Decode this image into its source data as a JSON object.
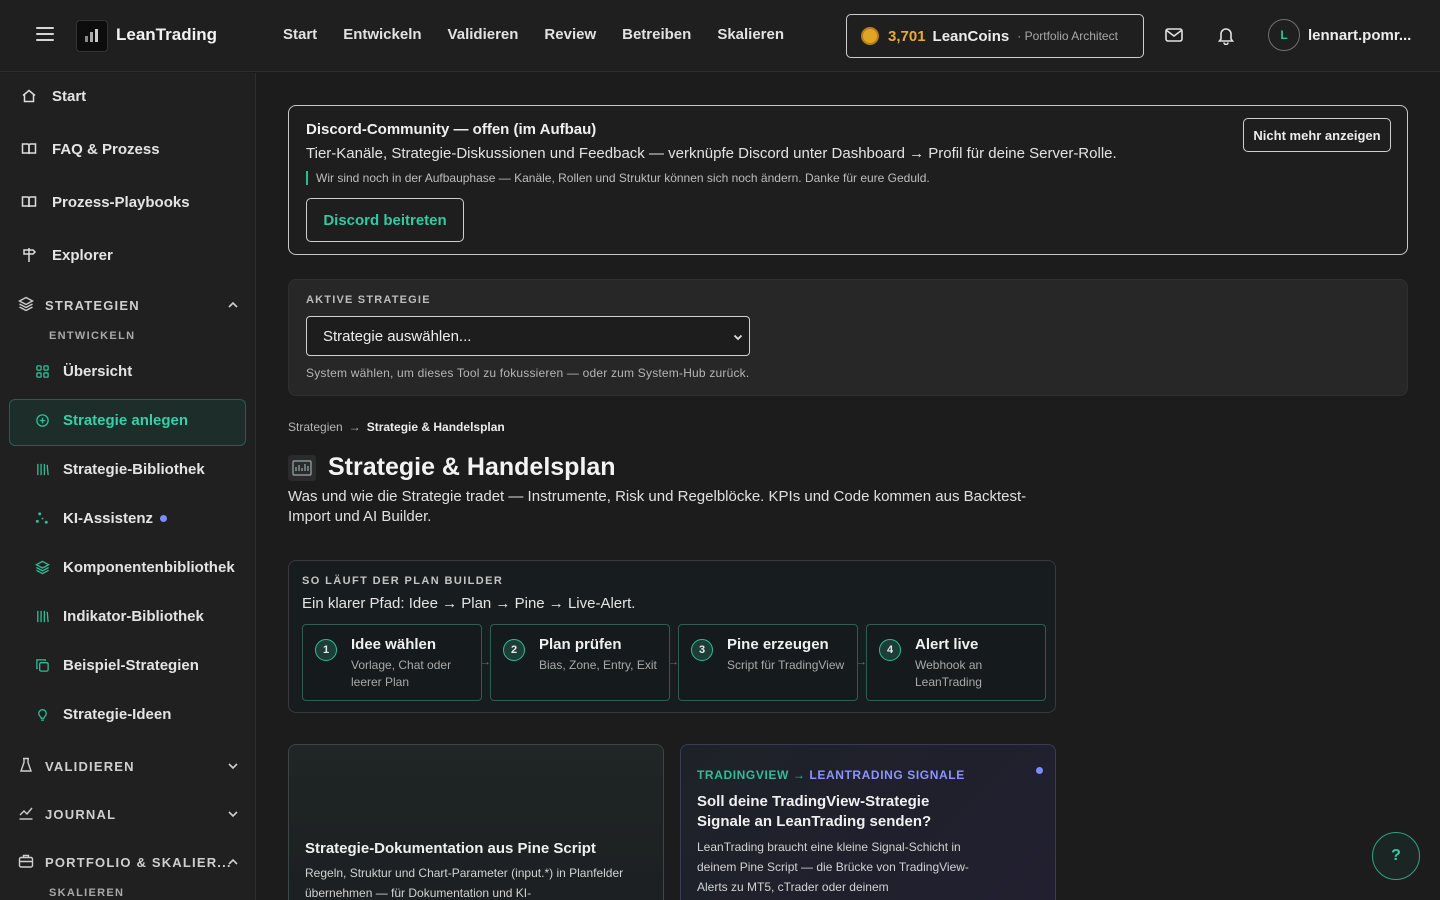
{
  "app": {
    "brand": "LeanTrading",
    "logo_icon": "leantrading-logo-icon"
  },
  "topnav": {
    "items": [
      "Start",
      "Entwickeln",
      "Validieren",
      "Review",
      "Betreiben",
      "Skalieren"
    ]
  },
  "coins": {
    "count": "3,701",
    "name": "LeanCoins",
    "rank": "· Portfolio Architect"
  },
  "user": {
    "initial": "L",
    "name": "lennart.pomr..."
  },
  "sidebar": {
    "items": [
      {
        "label": "Start",
        "icon": "home-icon"
      },
      {
        "label": "FAQ & Prozess",
        "icon": "book-icon"
      },
      {
        "label": "Prozess-Playbooks",
        "icon": "book-icon"
      },
      {
        "label": "Explorer",
        "icon": "signpost-icon"
      }
    ],
    "sections": [
      {
        "label": "STRATEGIEN",
        "icon": "layers-icon",
        "expanded": true
      },
      {
        "label": "VALIDIEREN",
        "icon": "flask-icon",
        "expanded": false
      },
      {
        "label": "JOURNAL",
        "icon": "chart-line-icon",
        "expanded": false
      },
      {
        "label": "PORTFOLIO & SKALIER...",
        "icon": "briefcase-icon",
        "expanded": true
      }
    ],
    "sub_entwickeln": "ENTWICKELN",
    "sub_skalieren": "SKALIEREN",
    "children": [
      {
        "label": "Übersicht",
        "icon": "grid-icon"
      },
      {
        "label": "Strategie anlegen",
        "icon": "plus-circle-icon",
        "active": true
      },
      {
        "label": "Strategie-Bibliothek",
        "icon": "library-icon"
      },
      {
        "label": "KI-Assistenz",
        "icon": "sparkle-icon",
        "badge": true
      },
      {
        "label": "Komponentenbibliothek",
        "icon": "layers-icon"
      },
      {
        "label": "Indikator-Bibliothek",
        "icon": "library-icon"
      },
      {
        "label": "Beispiel-Strategien",
        "icon": "copy-icon"
      },
      {
        "label": "Strategie-Ideen",
        "icon": "lightbulb-icon"
      }
    ]
  },
  "discord": {
    "title": "Discord-Community — offen (im Aufbau)",
    "desc": "Tier-Kanäle, Strategie-Diskussionen und Feedback — verknüpfe Discord unter Dashboard → Profil für deine Server-Rolle.",
    "note": "Wir sind noch in der Aufbauphase — Kanäle, Rollen und Struktur können sich noch ändern. Danke für eure Geduld.",
    "join_label": "Discord beitreten",
    "dismiss_label": "Nicht mehr anzeigen"
  },
  "active_strategy": {
    "label": "AKTIVE STRATEGIE",
    "selected": "Strategie auswählen...",
    "hint": "System wählen, um dieses Tool zu fokussieren — oder zum System-Hub zurück."
  },
  "breadcrumb": {
    "parent": "Strategien",
    "sep": "→",
    "current": "Strategie & Handelsplan"
  },
  "page": {
    "title": "Strategie & Handelsplan",
    "desc": "Was und wie die Strategie tradet — Instrumente, Risk und Regelblöcke. KPIs und Code kommen aus Backtest-Import und AI Builder."
  },
  "builder": {
    "kicker": "SO LÄUFT DER PLAN BUILDER",
    "sub": "Ein klarer Pfad: Idee → Plan → Pine → Live-Alert.",
    "steps": [
      {
        "num": "1",
        "title": "Idee wählen",
        "desc": "Vorlage, Chat oder leerer Plan"
      },
      {
        "num": "2",
        "title": "Plan prüfen",
        "desc": "Bias, Zone, Entry, Exit"
      },
      {
        "num": "3",
        "title": "Pine erzeugen",
        "desc": "Script für TradingView"
      },
      {
        "num": "4",
        "title": "Alert live",
        "desc": "Webhook an LeanTrading"
      }
    ]
  },
  "card_doc": {
    "title": "Strategie-Dokumentation aus Pine Script",
    "desc": "Regeln, Struktur und Chart-Parameter (input.*) in Planfelder übernehmen — für Dokumentation und KI-"
  },
  "card_signals": {
    "tag_a": "TRADINGVIEW →",
    "tag_b": "LEANTRADING SIGNALE",
    "title": "Soll deine TradingView-Strategie Signale an LeanTrading senden?",
    "desc": "LeanTrading braucht eine kleine Signal-Schicht in deinem Pine Script — die Brücke von TradingView-Alerts zu MT5, cTrader oder deinem"
  },
  "help": {
    "label": "?"
  },
  "colors": {
    "accent": "#2fbd97",
    "coin": "#e9a93a",
    "secondary": "#7b8cff"
  }
}
